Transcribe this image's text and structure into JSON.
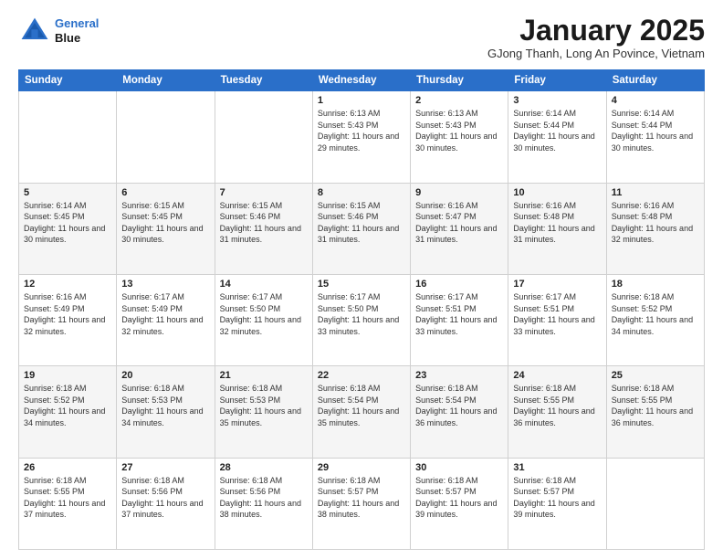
{
  "logo": {
    "line1": "General",
    "line2": "Blue"
  },
  "header": {
    "title": "January 2025",
    "subtitle": "GJong Thanh, Long An Povince, Vietnam"
  },
  "days_of_week": [
    "Sunday",
    "Monday",
    "Tuesday",
    "Wednesday",
    "Thursday",
    "Friday",
    "Saturday"
  ],
  "weeks": [
    [
      {
        "day": "",
        "sunrise": "",
        "sunset": "",
        "daylight": ""
      },
      {
        "day": "",
        "sunrise": "",
        "sunset": "",
        "daylight": ""
      },
      {
        "day": "",
        "sunrise": "",
        "sunset": "",
        "daylight": ""
      },
      {
        "day": "1",
        "sunrise": "Sunrise: 6:13 AM",
        "sunset": "Sunset: 5:43 PM",
        "daylight": "Daylight: 11 hours and 29 minutes."
      },
      {
        "day": "2",
        "sunrise": "Sunrise: 6:13 AM",
        "sunset": "Sunset: 5:43 PM",
        "daylight": "Daylight: 11 hours and 30 minutes."
      },
      {
        "day": "3",
        "sunrise": "Sunrise: 6:14 AM",
        "sunset": "Sunset: 5:44 PM",
        "daylight": "Daylight: 11 hours and 30 minutes."
      },
      {
        "day": "4",
        "sunrise": "Sunrise: 6:14 AM",
        "sunset": "Sunset: 5:44 PM",
        "daylight": "Daylight: 11 hours and 30 minutes."
      }
    ],
    [
      {
        "day": "5",
        "sunrise": "Sunrise: 6:14 AM",
        "sunset": "Sunset: 5:45 PM",
        "daylight": "Daylight: 11 hours and 30 minutes."
      },
      {
        "day": "6",
        "sunrise": "Sunrise: 6:15 AM",
        "sunset": "Sunset: 5:45 PM",
        "daylight": "Daylight: 11 hours and 30 minutes."
      },
      {
        "day": "7",
        "sunrise": "Sunrise: 6:15 AM",
        "sunset": "Sunset: 5:46 PM",
        "daylight": "Daylight: 11 hours and 31 minutes."
      },
      {
        "day": "8",
        "sunrise": "Sunrise: 6:15 AM",
        "sunset": "Sunset: 5:46 PM",
        "daylight": "Daylight: 11 hours and 31 minutes."
      },
      {
        "day": "9",
        "sunrise": "Sunrise: 6:16 AM",
        "sunset": "Sunset: 5:47 PM",
        "daylight": "Daylight: 11 hours and 31 minutes."
      },
      {
        "day": "10",
        "sunrise": "Sunrise: 6:16 AM",
        "sunset": "Sunset: 5:48 PM",
        "daylight": "Daylight: 11 hours and 31 minutes."
      },
      {
        "day": "11",
        "sunrise": "Sunrise: 6:16 AM",
        "sunset": "Sunset: 5:48 PM",
        "daylight": "Daylight: 11 hours and 32 minutes."
      }
    ],
    [
      {
        "day": "12",
        "sunrise": "Sunrise: 6:16 AM",
        "sunset": "Sunset: 5:49 PM",
        "daylight": "Daylight: 11 hours and 32 minutes."
      },
      {
        "day": "13",
        "sunrise": "Sunrise: 6:17 AM",
        "sunset": "Sunset: 5:49 PM",
        "daylight": "Daylight: 11 hours and 32 minutes."
      },
      {
        "day": "14",
        "sunrise": "Sunrise: 6:17 AM",
        "sunset": "Sunset: 5:50 PM",
        "daylight": "Daylight: 11 hours and 32 minutes."
      },
      {
        "day": "15",
        "sunrise": "Sunrise: 6:17 AM",
        "sunset": "Sunset: 5:50 PM",
        "daylight": "Daylight: 11 hours and 33 minutes."
      },
      {
        "day": "16",
        "sunrise": "Sunrise: 6:17 AM",
        "sunset": "Sunset: 5:51 PM",
        "daylight": "Daylight: 11 hours and 33 minutes."
      },
      {
        "day": "17",
        "sunrise": "Sunrise: 6:17 AM",
        "sunset": "Sunset: 5:51 PM",
        "daylight": "Daylight: 11 hours and 33 minutes."
      },
      {
        "day": "18",
        "sunrise": "Sunrise: 6:18 AM",
        "sunset": "Sunset: 5:52 PM",
        "daylight": "Daylight: 11 hours and 34 minutes."
      }
    ],
    [
      {
        "day": "19",
        "sunrise": "Sunrise: 6:18 AM",
        "sunset": "Sunset: 5:52 PM",
        "daylight": "Daylight: 11 hours and 34 minutes."
      },
      {
        "day": "20",
        "sunrise": "Sunrise: 6:18 AM",
        "sunset": "Sunset: 5:53 PM",
        "daylight": "Daylight: 11 hours and 34 minutes."
      },
      {
        "day": "21",
        "sunrise": "Sunrise: 6:18 AM",
        "sunset": "Sunset: 5:53 PM",
        "daylight": "Daylight: 11 hours and 35 minutes."
      },
      {
        "day": "22",
        "sunrise": "Sunrise: 6:18 AM",
        "sunset": "Sunset: 5:54 PM",
        "daylight": "Daylight: 11 hours and 35 minutes."
      },
      {
        "day": "23",
        "sunrise": "Sunrise: 6:18 AM",
        "sunset": "Sunset: 5:54 PM",
        "daylight": "Daylight: 11 hours and 36 minutes."
      },
      {
        "day": "24",
        "sunrise": "Sunrise: 6:18 AM",
        "sunset": "Sunset: 5:55 PM",
        "daylight": "Daylight: 11 hours and 36 minutes."
      },
      {
        "day": "25",
        "sunrise": "Sunrise: 6:18 AM",
        "sunset": "Sunset: 5:55 PM",
        "daylight": "Daylight: 11 hours and 36 minutes."
      }
    ],
    [
      {
        "day": "26",
        "sunrise": "Sunrise: 6:18 AM",
        "sunset": "Sunset: 5:55 PM",
        "daylight": "Daylight: 11 hours and 37 minutes."
      },
      {
        "day": "27",
        "sunrise": "Sunrise: 6:18 AM",
        "sunset": "Sunset: 5:56 PM",
        "daylight": "Daylight: 11 hours and 37 minutes."
      },
      {
        "day": "28",
        "sunrise": "Sunrise: 6:18 AM",
        "sunset": "Sunset: 5:56 PM",
        "daylight": "Daylight: 11 hours and 38 minutes."
      },
      {
        "day": "29",
        "sunrise": "Sunrise: 6:18 AM",
        "sunset": "Sunset: 5:57 PM",
        "daylight": "Daylight: 11 hours and 38 minutes."
      },
      {
        "day": "30",
        "sunrise": "Sunrise: 6:18 AM",
        "sunset": "Sunset: 5:57 PM",
        "daylight": "Daylight: 11 hours and 39 minutes."
      },
      {
        "day": "31",
        "sunrise": "Sunrise: 6:18 AM",
        "sunset": "Sunset: 5:57 PM",
        "daylight": "Daylight: 11 hours and 39 minutes."
      },
      {
        "day": "",
        "sunrise": "",
        "sunset": "",
        "daylight": ""
      }
    ]
  ]
}
